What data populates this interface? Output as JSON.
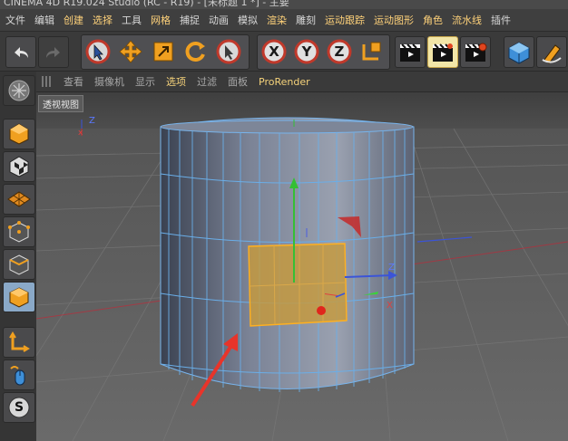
{
  "app": {
    "title": "CINEMA 4D R19.024 Studio (RC - R19) - [未标题 1 *] - 主要"
  },
  "menu": [
    {
      "label": "文件",
      "color": "#d8d8d8"
    },
    {
      "label": "编辑",
      "color": "#d8d8d8"
    },
    {
      "label": "创建",
      "color": "#ffd27a"
    },
    {
      "label": "选择",
      "color": "#ffd27a"
    },
    {
      "label": "工具",
      "color": "#d8d8d8"
    },
    {
      "label": "网格",
      "color": "#ffd27a"
    },
    {
      "label": "捕捉",
      "color": "#d8d8d8"
    },
    {
      "label": "动画",
      "color": "#d8d8d8"
    },
    {
      "label": "模拟",
      "color": "#d8d8d8"
    },
    {
      "label": "渲染",
      "color": "#ffd27a"
    },
    {
      "label": "雕刻",
      "color": "#d8d8d8"
    },
    {
      "label": "运动跟踪",
      "color": "#ffd27a"
    },
    {
      "label": "运动图形",
      "color": "#ffd27a"
    },
    {
      "label": "角色",
      "color": "#ffd27a"
    },
    {
      "label": "流水线",
      "color": "#ffd27a"
    },
    {
      "label": "插件",
      "color": "#d8d8d8"
    }
  ],
  "toolbar": {
    "axis_x": "X",
    "axis_y": "Y",
    "axis_z": "Z",
    "icons": [
      "undo-icon",
      "redo-icon",
      "live-selection-icon",
      "move-icon",
      "scale-icon",
      "rotate-icon",
      "recent-tool-icon",
      "lock-x-icon",
      "lock-y-icon",
      "lock-z-icon",
      "coordinate-system-icon",
      "render-view-icon",
      "render-picture-viewer-icon",
      "render-settings-icon",
      "cube-primitive-icon",
      "pen-spline-icon"
    ]
  },
  "view_menu": [
    {
      "label": "查看",
      "active": false
    },
    {
      "label": "摄像机",
      "active": false
    },
    {
      "label": "显示",
      "active": false
    },
    {
      "label": "选项",
      "active": true
    },
    {
      "label": "过滤",
      "active": false
    },
    {
      "label": "面板",
      "active": false
    },
    {
      "label": "ProRender",
      "active": true
    }
  ],
  "viewport": {
    "label": "透视视图",
    "axis_z": "Z",
    "axis_x": "X",
    "mini_axis_z": "Z",
    "mini_axis_x": "x"
  },
  "leftbar": {
    "mode_icons": [
      "make-editable-icon",
      "model-mode-icon",
      "texture-mode-icon",
      "workplane-icon",
      "points-mode-icon",
      "edges-mode-icon",
      "polygons-mode-icon",
      "enable-axis-icon",
      "tweak-mode-icon",
      "snap-icon"
    ],
    "snap_letter": "S"
  },
  "colors": {
    "accent_orange": "#e09a2c",
    "active_menu": "#f5d27a",
    "selection_fill": "#c89a3a",
    "wire_blue": "#5fa7e8",
    "annotation_red": "#e8342a"
  }
}
